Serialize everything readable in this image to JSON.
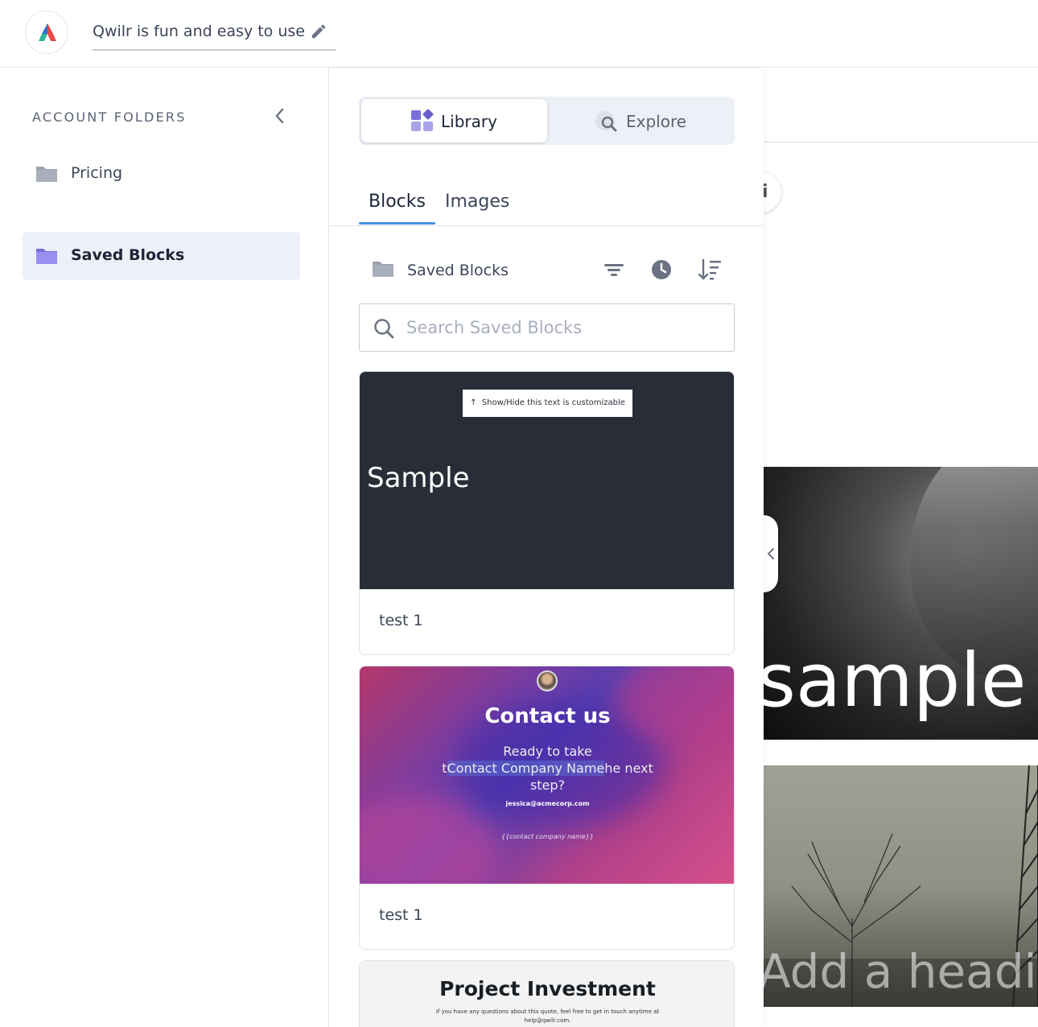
{
  "header": {
    "doc_title": "Qwilr is fun and easy to use",
    "logo_icon": "qwilr-logo-icon",
    "edit_icon": "pencil-icon"
  },
  "sidebar": {
    "heading": "ACCOUNT FOLDERS",
    "collapse_icon": "chevron-left-icon",
    "folders": [
      {
        "label": "Pricing",
        "icon": "folder-icon",
        "active": false
      },
      {
        "label": "Saved Blocks",
        "icon": "folder-icon",
        "active": true
      }
    ]
  },
  "library": {
    "segments": [
      {
        "label": "Library",
        "icon": "library-icon",
        "selected": true
      },
      {
        "label": "Explore",
        "icon": "explore-icon",
        "selected": false
      }
    ],
    "tabs": [
      {
        "label": "Blocks",
        "selected": true
      },
      {
        "label": "Images",
        "selected": false
      }
    ],
    "current_folder": "Saved Blocks",
    "tools": [
      "filter-icon",
      "history-icon",
      "sort-icon"
    ],
    "search": {
      "placeholder": "Search Saved Blocks",
      "value": ""
    },
    "cards": [
      {
        "label": "test 1",
        "thumb": {
          "pill_text": "Show/Hide this text is customizable",
          "heading": "Sample"
        }
      },
      {
        "label": "test 1",
        "thumb": {
          "title": "Contact us",
          "line1": "Ready to take",
          "line2_pre": "t",
          "line2_highlight": "Contact Company Name",
          "line2_post": "he next",
          "line3": "step?",
          "email": "jessica@acmecorp.com",
          "company": "{{contact company name}}"
        }
      },
      {
        "label": "",
        "thumb": {
          "title": "Project Investment",
          "subtitle": "If you have any questions about this quote, feel free to get in touch anytime at help@qwilr.com."
        }
      }
    ]
  },
  "editor": {
    "hero_text": "sample",
    "heading_placeholder": "Add a headin",
    "info_icon": "info-icon",
    "collapse_icon": "chevron-left-icon"
  },
  "colors": {
    "accent": "#4a90e2",
    "active_folder_bg": "#edf0f8",
    "folder_active": "#8a7fe0",
    "folder_inactive": "#9aa0ad"
  }
}
